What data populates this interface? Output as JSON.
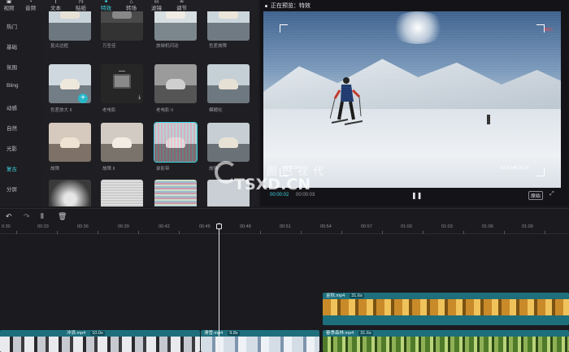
{
  "toolbar": {
    "items": [
      {
        "label": "视频",
        "icon": "video-icon"
      },
      {
        "label": "音频",
        "icon": "audio-icon"
      },
      {
        "label": "文本",
        "icon": "text-icon"
      },
      {
        "label": "贴纸",
        "icon": "sticker-icon"
      },
      {
        "label": "特效",
        "icon": "effects-icon"
      },
      {
        "label": "转场",
        "icon": "transition-icon"
      },
      {
        "label": "滤镜",
        "icon": "filter-icon"
      },
      {
        "label": "调节",
        "icon": "adjust-icon"
      }
    ],
    "active": "特效"
  },
  "categories": {
    "items": [
      "热门",
      "基础",
      "氛围",
      "Bling",
      "动感",
      "自然",
      "光影",
      "复古",
      "分屏"
    ],
    "active": "复古"
  },
  "effects": {
    "row1": [
      "复古边框",
      "万圣佳",
      "放映机闪动",
      "色差故障"
    ],
    "row2": [
      "色差放大 II",
      "老电影",
      "老电影 II",
      "模糊化"
    ],
    "row3": [
      "故障",
      "故障 II",
      "录影带",
      "故障"
    ],
    "selected": "录影带"
  },
  "preview": {
    "title": "正在预览：特效",
    "current_time": "00:00:02",
    "duration": "00:00:03",
    "ratio_button": "原始",
    "rec_badge": "REC",
    "timestamp_left": "01 15.05",
    "timestamp_right": "F2.3 0dB 15.7V"
  },
  "watermark": {
    "cn": "图巴视代",
    "en": "TSXD.CN"
  },
  "timeline": {
    "tools": [
      "undo-icon",
      "redo-icon",
      "split-icon",
      "delete-icon"
    ],
    "ruler": [
      "0:30",
      "00:33",
      "00:36",
      "00:39",
      "00:42",
      "00:45",
      "00:48",
      "00:51",
      "00:54",
      "00:57",
      "01:00",
      "01:03",
      "01:06",
      "01:09"
    ],
    "clips": [
      {
        "name": "金秋.mp4",
        "duration": "31.6s"
      },
      {
        "name": "冲浪.mp4",
        "duration": "10.0s"
      },
      {
        "name": "滑雪.mp4",
        "duration": "9.8s"
      },
      {
        "name": "春季森林.mp4",
        "duration": "31.6s"
      }
    ]
  },
  "colors": {
    "accent": "#3fd4e0",
    "clip_header": "#1e6f7c",
    "background": "#1b1b1f"
  }
}
